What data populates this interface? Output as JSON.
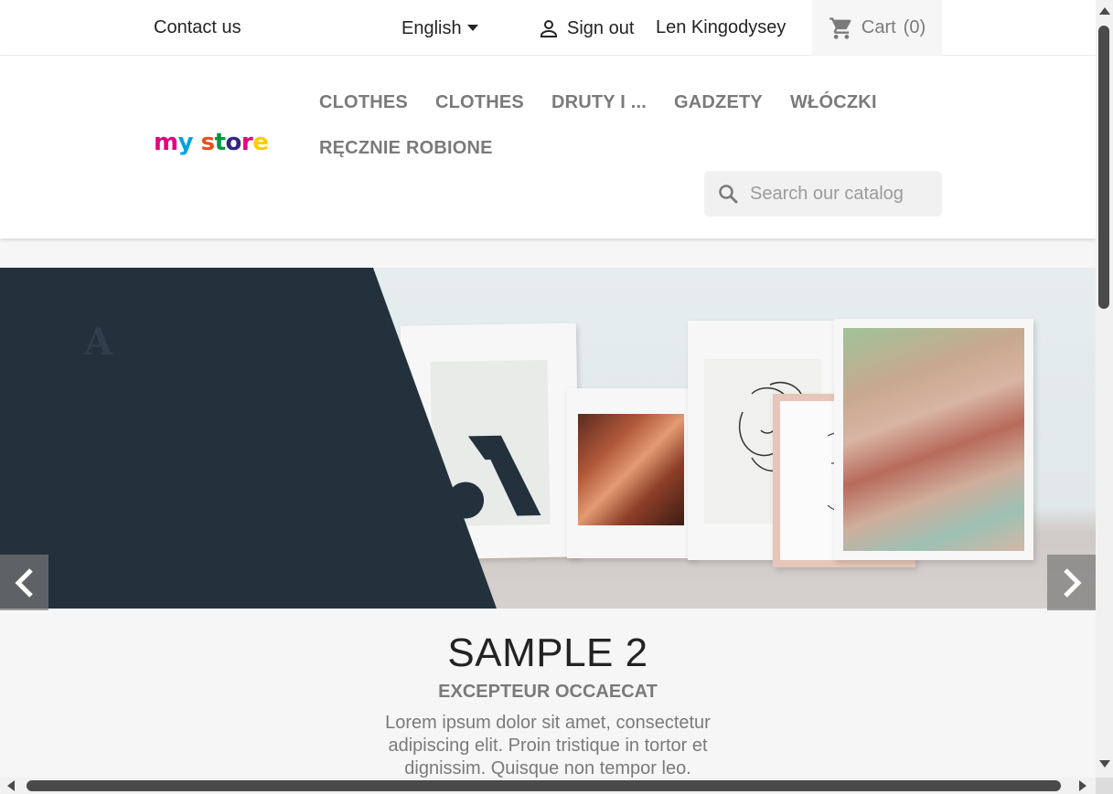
{
  "topbar": {
    "contact": "Contact us",
    "language": "English",
    "signout": "Sign out",
    "username": "Len Kingodysey",
    "cart": "Cart",
    "cart_count": "(0)"
  },
  "header": {
    "logo_text": "my store",
    "menu": [
      "CLOTHES",
      "CLOTHES",
      "DRUTY I ...",
      "GADZETY",
      "WŁÓCZKI",
      "RĘCZNIE ROBIONE"
    ],
    "search_placeholder": "Search our catalog"
  },
  "slider": {
    "title": "SAMPLE 2",
    "subtitle": "EXCEPTEUR OCCAECAT",
    "text": "Lorem ipsum dolor sit amet, consectetur adipiscing elit. Proin tristique in tortor et dignissim. Quisque non tempor leo."
  },
  "colors": {
    "dark_panel": "#23313d",
    "menu_text": "#7a7a7a",
    "text": "#232323"
  },
  "icons": {
    "user": "person-icon",
    "cart": "shopping-cart-icon",
    "search": "search-icon",
    "prev": "chevron-left-icon",
    "next": "chevron-right-icon"
  }
}
